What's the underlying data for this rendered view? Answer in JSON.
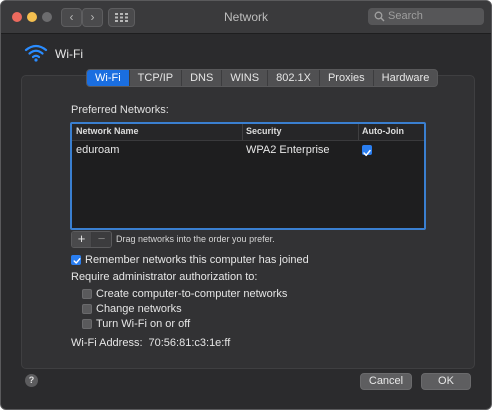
{
  "window": {
    "title": "Network"
  },
  "search": {
    "placeholder": "Search"
  },
  "interface": {
    "name": "Wi-Fi"
  },
  "tabs": [
    {
      "label": "Wi-Fi",
      "active": true
    },
    {
      "label": "TCP/IP"
    },
    {
      "label": "DNS"
    },
    {
      "label": "WINS"
    },
    {
      "label": "802.1X"
    },
    {
      "label": "Proxies"
    },
    {
      "label": "Hardware"
    }
  ],
  "preferred": {
    "label": "Preferred Networks:",
    "columns": [
      "Network Name",
      "Security",
      "Auto-Join"
    ],
    "rows": [
      {
        "name": "eduroam",
        "security": "WPA2 Enterprise",
        "auto_join": true
      }
    ],
    "add_label": "+",
    "remove_label": "−",
    "hint": "Drag networks into the order you prefer."
  },
  "remember": {
    "label": "Remember networks this computer has joined",
    "checked": true
  },
  "admin": {
    "label": "Require administrator authorization to:",
    "options": [
      {
        "label": "Create computer-to-computer networks",
        "checked": false
      },
      {
        "label": "Change networks",
        "checked": false
      },
      {
        "label": "Turn Wi-Fi on or off",
        "checked": false
      }
    ]
  },
  "address": {
    "label": "Wi-Fi Address:",
    "value": "70:56:81:c3:1e:ff"
  },
  "footer": {
    "help": "?",
    "cancel": "Cancel",
    "ok": "OK"
  },
  "colors": {
    "accent": "#2a7ef0",
    "window_bg": "#2b2b2d",
    "tab_active": "#1a6ee0"
  }
}
